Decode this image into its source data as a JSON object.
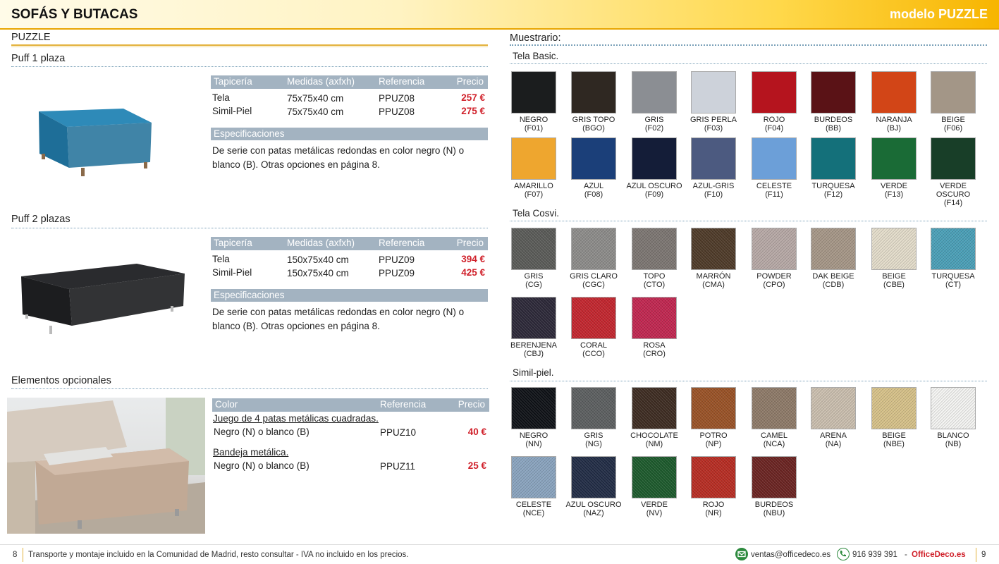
{
  "header": {
    "title": "SOFÁS Y BUTACAS",
    "model": "modelo PUZZLE"
  },
  "left": {
    "section": "PUZZLE",
    "p1": {
      "title": "Puff 1 plaza",
      "head": [
        "Tapicería",
        "Medidas (axfxh)",
        "Referencia",
        "Precio"
      ],
      "rows": [
        [
          "Tela",
          "75x75x40 cm",
          "PPUZ08",
          "257 €"
        ],
        [
          "Simil-Piel",
          "75x75x40 cm",
          "PPUZ08",
          "275 €"
        ]
      ],
      "spec_title": "Especificaciones",
      "spec": "De serie con patas metálicas redondas en color negro (N) o blanco (B). Otras opciones en página 8.",
      "color": "#1e6e98"
    },
    "p2": {
      "title": "Puff 2 plazas",
      "head": [
        "Tapicería",
        "Medidas (axfxh)",
        "Referencia",
        "Precio"
      ],
      "rows": [
        [
          "Tela",
          "150x75x40 cm",
          "PPUZ09",
          "394 €"
        ],
        [
          "Simil-Piel",
          "150x75x40 cm",
          "PPUZ09",
          "425 €"
        ]
      ],
      "spec_title": "Especificaciones",
      "spec": "De serie con patas metálicas redondas en color negro (N) o blanco (B). Otras opciones en página 8.",
      "color": "#1c1d1f"
    },
    "opt": {
      "title": "Elementos opcionales",
      "head": [
        "Color",
        "Referencia",
        "Precio"
      ],
      "i1": {
        "name": "Juego de 4 patas metálicas cuadradas.",
        "desc": "Negro (N) o blanco (B)",
        "ref": "PPUZ10",
        "price": "40 €"
      },
      "i2": {
        "name": "Bandeja metálica.",
        "desc": "Negro (N) o blanco (B)",
        "ref": "PPUZ11",
        "price": "25 €"
      }
    }
  },
  "right": {
    "title": "Muestrario:",
    "basic": {
      "title": "Tela Basic.",
      "items": [
        {
          "n": "NEGRO",
          "c": "(F01)",
          "col": "#1b1d1e"
        },
        {
          "n": "GRIS TOPO",
          "c": "(BGO)",
          "col": "#2f2822"
        },
        {
          "n": "GRIS",
          "c": "(F02)",
          "col": "#8b8e93"
        },
        {
          "n": "GRIS PERLA",
          "c": "(F03)",
          "col": "#cdd2da"
        },
        {
          "n": "ROJO",
          "c": "(F04)",
          "col": "#b5141e"
        },
        {
          "n": "BURDEOS",
          "c": "(BB)",
          "col": "#5a1216"
        },
        {
          "n": "NARANJA",
          "c": "(BJ)",
          "col": "#d24517"
        },
        {
          "n": "BEIGE",
          "c": "(F06)",
          "col": "#a39687"
        },
        {
          "n": "AMARILLO",
          "c": "(F07)",
          "col": "#eea62f"
        },
        {
          "n": "AZUL",
          "c": "(F08)",
          "col": "#1b3f79"
        },
        {
          "n": "AZUL OSCURO",
          "c": "(F09)",
          "col": "#141d38"
        },
        {
          "n": "AZUL-GRIS",
          "c": "(F10)",
          "col": "#4c5a80"
        },
        {
          "n": "CELESTE",
          "c": "(F11)",
          "col": "#6c9fd8"
        },
        {
          "n": "TURQUESA",
          "c": "(F12)",
          "col": "#14707a"
        },
        {
          "n": "VERDE",
          "c": "(F13)",
          "col": "#1a6b36"
        },
        {
          "n": "VERDE OSCURO",
          "c": "(F14)",
          "col": "#183e28"
        }
      ]
    },
    "cosvi": {
      "title": "Tela Cosvi.",
      "items": [
        {
          "n": "GRIS",
          "c": "(CG)",
          "col": "#5a5b58"
        },
        {
          "n": "GRIS CLARO",
          "c": "(CGC)",
          "col": "#8d8c8a"
        },
        {
          "n": "TOPO",
          "c": "(CTO)",
          "col": "#7c7672"
        },
        {
          "n": "MARRÓN",
          "c": "(CMA)",
          "col": "#4e3a28"
        },
        {
          "n": "POWDER",
          "c": "(CPO)",
          "col": "#b7a9a6"
        },
        {
          "n": "DAK BEIGE",
          "c": "(CDB)",
          "col": "#a69787"
        },
        {
          "n": "BEIGE",
          "c": "(CBE)",
          "col": "#e4ddcb"
        },
        {
          "n": "TURQUESA",
          "c": "(CT)",
          "col": "#4aa0b8"
        },
        {
          "n": "BERENJENA",
          "c": "(CBJ)",
          "col": "#2c2838"
        },
        {
          "n": "CORAL",
          "c": "(CCO)",
          "col": "#c4252e"
        },
        {
          "n": "ROSA",
          "c": "(CRO)",
          "col": "#c22650"
        }
      ]
    },
    "simil": {
      "title": "Simil-piel.",
      "items": [
        {
          "n": "NEGRO",
          "c": "(NN)",
          "col": "#0e1116"
        },
        {
          "n": "GRIS",
          "c": "(NG)",
          "col": "#5c5f60"
        },
        {
          "n": "CHOCOLATE",
          "c": "(NM)",
          "col": "#3d2b21"
        },
        {
          "n": "POTRO",
          "c": "(NP)",
          "col": "#9a5226"
        },
        {
          "n": "CAMEL",
          "c": "(NCA)",
          "col": "#8e7a68"
        },
        {
          "n": "ARENA",
          "c": "(NA)",
          "col": "#cbbfaf"
        },
        {
          "n": "BEIGE",
          "c": "(NBE)",
          "col": "#d7c289"
        },
        {
          "n": "BLANCO",
          "c": "(NB)",
          "col": "#f4f4f2"
        },
        {
          "n": "CELESTE",
          "c": "(NCE)",
          "col": "#8aa4bf"
        },
        {
          "n": "AZUL OSCURO",
          "c": "(NAZ)",
          "col": "#212c45"
        },
        {
          "n": "VERDE",
          "c": "(NV)",
          "col": "#1c5a2c"
        },
        {
          "n": "ROJO",
          "c": "(NR)",
          "col": "#b82c22"
        },
        {
          "n": "BURDEOS",
          "c": "(NBU)",
          "col": "#6b2321"
        }
      ]
    }
  },
  "footer": {
    "page_left": "8",
    "text": "Transporte y montaje incluido en la Comunidad de Madrid, resto consultar - IVA no incluido en los precios.",
    "email": "ventas@officedeco.es",
    "phone": "916 939 391",
    "dash": "-",
    "brand": "OfficeDeco.es",
    "page_right": "9"
  }
}
